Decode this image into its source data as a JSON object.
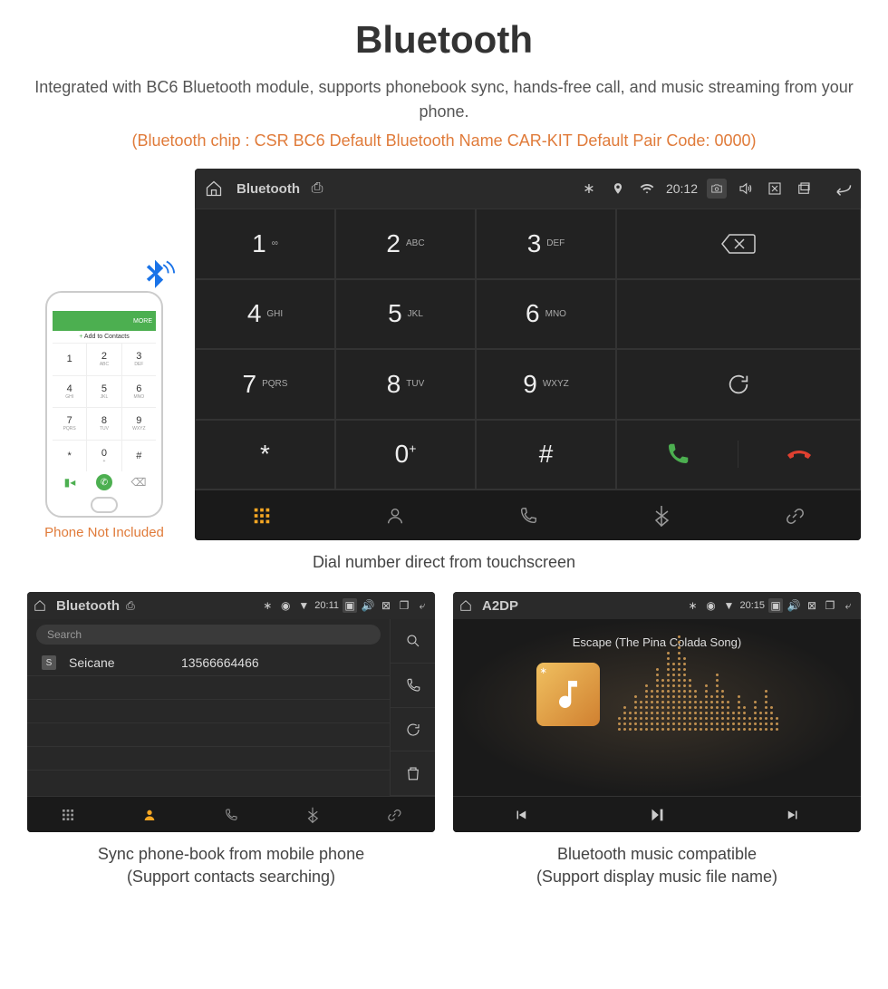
{
  "header": {
    "title": "Bluetooth",
    "description": "Integrated with BC6 Bluetooth module, supports phonebook sync, hands-free call, and music streaming from your phone.",
    "specs": "(Bluetooth chip : CSR BC6     Default Bluetooth Name CAR-KIT     Default Pair Code: 0000)"
  },
  "phone": {
    "add_contacts": "Add to Contacts",
    "more": "MORE",
    "note": "Phone Not Included",
    "keys": [
      {
        "n": "1",
        "s": ""
      },
      {
        "n": "2",
        "s": "ABC"
      },
      {
        "n": "3",
        "s": "DEF"
      },
      {
        "n": "4",
        "s": "GHI"
      },
      {
        "n": "5",
        "s": "JKL"
      },
      {
        "n": "6",
        "s": "MNO"
      },
      {
        "n": "7",
        "s": "PQRS"
      },
      {
        "n": "8",
        "s": "TUV"
      },
      {
        "n": "9",
        "s": "WXYZ"
      },
      {
        "n": "*",
        "s": ""
      },
      {
        "n": "0",
        "s": "+"
      },
      {
        "n": "#",
        "s": ""
      }
    ]
  },
  "dialer": {
    "status_title": "Bluetooth",
    "time": "20:12",
    "keys": [
      {
        "n": "1",
        "s": "∞"
      },
      {
        "n": "2",
        "s": "ABC"
      },
      {
        "n": "3",
        "s": "DEF"
      },
      {
        "n": "4",
        "s": "GHI"
      },
      {
        "n": "5",
        "s": "JKL"
      },
      {
        "n": "6",
        "s": "MNO"
      },
      {
        "n": "7",
        "s": "PQRS"
      },
      {
        "n": "8",
        "s": "TUV"
      },
      {
        "n": "9",
        "s": "WXYZ"
      },
      {
        "n": "*",
        "s": ""
      },
      {
        "n": "0",
        "s": "",
        "sup": "+"
      },
      {
        "n": "#",
        "s": ""
      }
    ],
    "caption": "Dial number direct from touchscreen"
  },
  "contacts": {
    "status_title": "Bluetooth",
    "time": "20:11",
    "search": "Search",
    "items": [
      {
        "badge": "S",
        "name": "Seicane",
        "number": "13566664466"
      }
    ],
    "caption_l1": "Sync phone-book from mobile phone",
    "caption_l2": "(Support contacts searching)"
  },
  "music": {
    "status_title": "A2DP",
    "time": "20:15",
    "song": "Escape (The Pina Colada Song)",
    "caption_l1": "Bluetooth music compatible",
    "caption_l2": "(Support display music file name)"
  }
}
